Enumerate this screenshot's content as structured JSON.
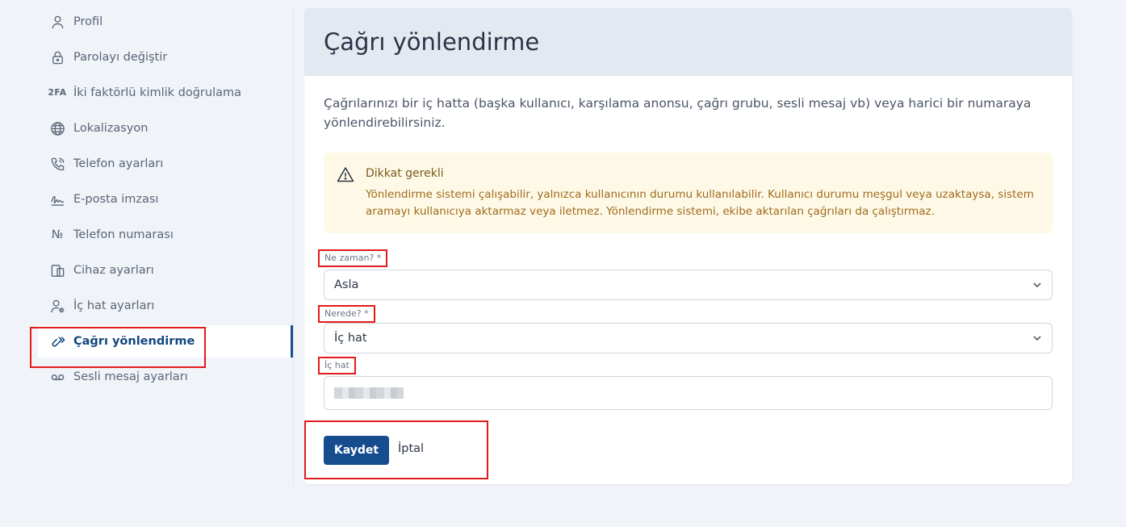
{
  "sidebar": {
    "items": [
      {
        "label": "Profil",
        "icon": "user-icon"
      },
      {
        "label": "Parolayı değiştir",
        "icon": "lock-icon"
      },
      {
        "label": "İki faktörlü kimlik doğrulama",
        "icon": "2fa-icon",
        "icon_text": "2FA"
      },
      {
        "label": "Lokalizasyon",
        "icon": "globe-icon"
      },
      {
        "label": "Telefon ayarları",
        "icon": "phone-icon"
      },
      {
        "label": "E-posta imzası",
        "icon": "signature-icon"
      },
      {
        "label": "Telefon numarası",
        "icon": "number-sign-icon",
        "icon_text": "№"
      },
      {
        "label": "Cihaz ayarları",
        "icon": "devices-icon"
      },
      {
        "label": "İç hat ayarları",
        "icon": "user-gear-icon"
      },
      {
        "label": "Çağrı yönlendirme",
        "icon": "call-forward-icon",
        "active": true
      },
      {
        "label": "Sesli mesaj ayarları",
        "icon": "voicemail-icon"
      }
    ]
  },
  "main": {
    "title": "Çağrı yönlendirme",
    "description": "Çağrılarınızı bir iç hatta (başka kullanıcı, karşılama anonsu, çağrı grubu, sesli mesaj vb) veya harici bir numaraya yönlendirebilirsiniz.",
    "alert": {
      "title": "Dikkat gerekli",
      "text": "Yönlendirme sistemi çalışabilir, yalnızca kullanıcının durumu kullanılabilir. Kullanıcı durumu meşgul veya uzaktaysa, sistem aramayı kullanıcıya aktarmaz veya iletmez. Yönlendirme sistemi, ekibe aktarılan çağrıları da çalıştırmaz.",
      "icon": "warning-icon"
    },
    "fields": {
      "when": {
        "label": "Ne zaman? *",
        "value": "Asla"
      },
      "where": {
        "label": "Nerede? *",
        "value": "İç hat"
      },
      "extension": {
        "label": "İç hat"
      }
    },
    "actions": {
      "save": "Kaydet",
      "cancel": "İptal"
    }
  },
  "colors": {
    "accent": "#154d8e",
    "highlight_frame": "#e21b1b",
    "alert_bg": "#fef9e7",
    "header_bg": "#e4e9f1",
    "page_bg": "#f0f3f8"
  }
}
